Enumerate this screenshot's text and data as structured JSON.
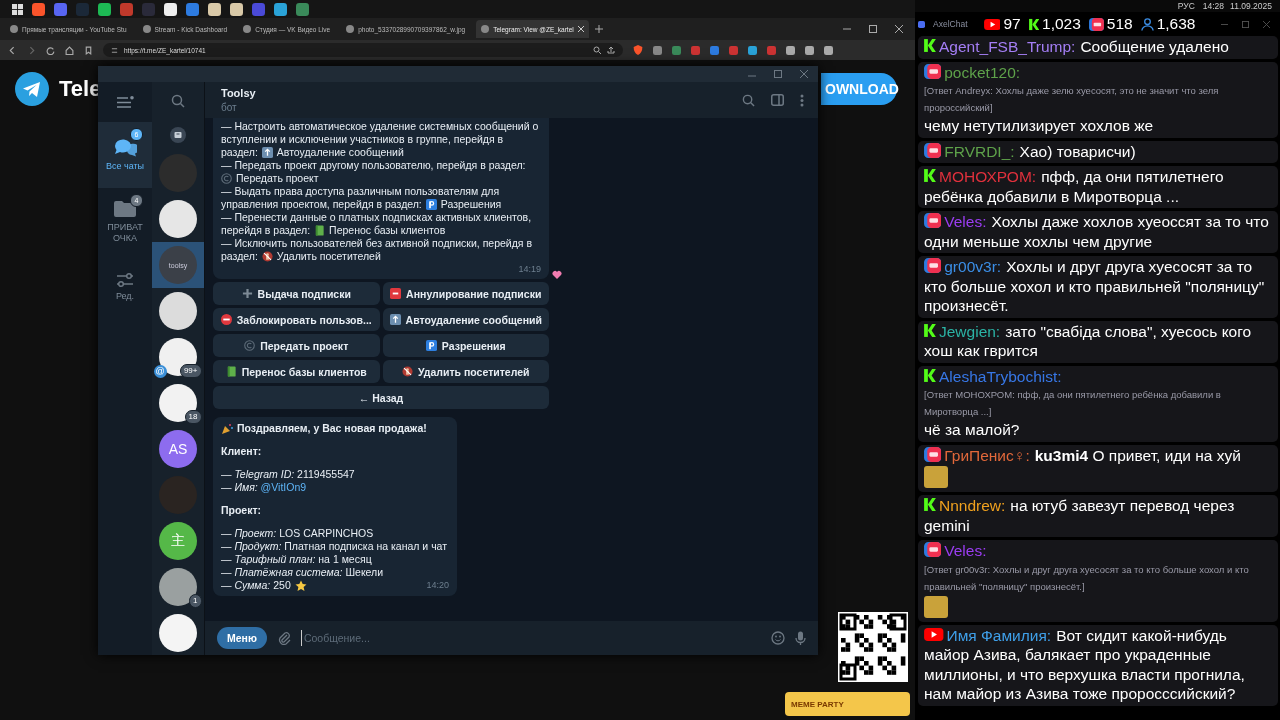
{
  "browser": {
    "tabs": [
      {
        "title": "Прямые трансляции - YouTube Stu",
        "selected": false
      },
      {
        "title": "Stream - Kick Dashboard",
        "selected": false
      },
      {
        "title": "Студия — VK Видео Live",
        "selected": false
      },
      {
        "title": "photo_5337028990709397862_w.jpg",
        "selected": false
      },
      {
        "title": "Telegram: View @ZE_kartel",
        "selected": true
      }
    ],
    "address": "https://t.me/ZE_kartel/10741"
  },
  "system_tray": {
    "language": "РУС",
    "time": "14:28",
    "date": "11.09.2025"
  },
  "web_page": {
    "brand": "Tele",
    "download_button": "OWNLOAD",
    "widget_title": "MEME PARTY"
  },
  "telegram": {
    "folders": [
      {
        "kind": "all",
        "label": "Все чаты",
        "badge": "6",
        "selected": true
      },
      {
        "kind": "folder",
        "label": "ПРИВАТ ОЧКА",
        "badge": "4",
        "selected": false
      },
      {
        "kind": "edit",
        "label": "Ред.",
        "selected": false
      }
    ],
    "chats": [
      {
        "color": "#2c2c2c",
        "selected": false
      },
      {
        "color": "#e6e6e6",
        "selected": false
      },
      {
        "label": "toolsy",
        "color": "#3b4048",
        "selected": true
      },
      {
        "color": "#dcdcdc",
        "selected": false
      },
      {
        "color": "#f0f0f0",
        "mention": "@",
        "badge": "99+",
        "selected": false
      },
      {
        "color": "#f2f2f2",
        "badge": "18",
        "selected": false
      },
      {
        "label": "AS",
        "color": "#8d6cef",
        "selected": false
      },
      {
        "color": "#2a2421",
        "selected": false
      },
      {
        "label": "主",
        "color": "#55b848",
        "selected": false
      },
      {
        "color": "#9aa0a0",
        "badge": "1",
        "selected": false
      },
      {
        "color": "#f4f4f4",
        "selected": false
      }
    ],
    "header": {
      "title": "Toolsy",
      "subtitle": "бот"
    },
    "bot_message": {
      "time": "14:19",
      "lines": [
        {
          "kind": "plain",
          "text": "— Настроить автоматическое удаление системных сообщений о"
        },
        {
          "kind": "plain",
          "text": "вступлении и исключении участников в группе, перейдя в"
        },
        {
          "kind": "autodelete",
          "text": "раздел:",
          "section": "Автоудаление сообщений"
        },
        {
          "kind": "plain",
          "text": "— Передать проект другому пользователю, перейдя в раздел:"
        },
        {
          "kind": "transfer",
          "section": "Передать проект"
        },
        {
          "kind": "plain",
          "text": "— Выдать права доступа различным пользователям для"
        },
        {
          "kind": "permissions",
          "text": "управления проектом, перейдя в раздел:",
          "section": "Разрешения"
        },
        {
          "kind": "plain",
          "text": "— Перенести данные о платных подписках активных клиентов,"
        },
        {
          "kind": "migrate",
          "text": "перейдя в раздел:",
          "section": "Перенос базы клиентов"
        },
        {
          "kind": "plain",
          "text": "— Исключить пользователей без активной подписки, перейдя в"
        },
        {
          "kind": "remove",
          "text": "раздел:",
          "section": "Удалить посетителей"
        }
      ]
    },
    "keyboard": [
      {
        "kind": "grant",
        "label": "Выдача подписки"
      },
      {
        "kind": "revoke",
        "label": "Аннулирование подписки"
      },
      {
        "kind": "block",
        "label": "Заблокировать пользов..."
      },
      {
        "kind": "autodelete",
        "label": "Автоудаление сообщений"
      },
      {
        "kind": "transfer",
        "label": "Передать проект"
      },
      {
        "kind": "permissions",
        "label": "Разрешения"
      },
      {
        "kind": "migrate",
        "label": "Перенос базы клиентов"
      },
      {
        "kind": "remove",
        "label": "Удалить посетителей"
      }
    ],
    "back_button": "← Назад",
    "sale_message": {
      "time": "14:20",
      "lines": [
        {
          "kind": "title",
          "text": "Поздравляем, у Вас новая продажа!"
        },
        {
          "kind": "heading",
          "text": "Клиент:"
        },
        {
          "kind": "field",
          "text": "— *Telegram ID:* 2119455547"
        },
        {
          "kind": "field",
          "text": "— *Имя:*",
          "link": "@VitIOn9"
        },
        {
          "kind": "heading",
          "text": "Проект:"
        },
        {
          "kind": "field",
          "text": "— *Проект:* LOS CARPINCHOS"
        },
        {
          "kind": "field",
          "text": "— *Продукт:* Платная подписка на канал и чат"
        },
        {
          "kind": "field",
          "text": "— *Тарифный план:* на 1 месяц"
        },
        {
          "kind": "field",
          "text": "— *Платёжная система:* Шекели"
        },
        {
          "kind": "amount",
          "text": "— *Сумма:* 250"
        }
      ]
    },
    "input": {
      "menu_button": "Меню",
      "placeholder": "Сообщение..."
    }
  },
  "chat_overlay": {
    "app_title": "AxelChat",
    "stats": [
      {
        "kind": "youtube",
        "value": "97"
      },
      {
        "kind": "kick",
        "value": "1,023"
      },
      {
        "kind": "vk",
        "value": "518"
      },
      {
        "kind": "viewers",
        "value": "1,638"
      }
    ],
    "messages": [
      {
        "kind": "kick",
        "author": "Agent_FSB_Trump:",
        "color": "#a47ef5",
        "text": "Сообщение удалено"
      },
      {
        "kind": "vk",
        "author": "pocket120:",
        "color": "#5ea24a",
        "reply": "[Ответ Andreyx: Хохлы даже зелю хуесосят, это не значит что зеля пророссийский]",
        "text": "чему нетутилизирует хохлов же"
      },
      {
        "kind": "vk",
        "author": "FRVRDI_:",
        "color": "#5ea24a",
        "text": "Хао) товарисчи)"
      },
      {
        "kind": "kick",
        "author": "МОНОХРОМ:",
        "color": "#e0303c",
        "text": "пфф, да они пятилетнего ребёнка добавили в Миротворца ..."
      },
      {
        "kind": "vk",
        "author": "Veles:",
        "color": "#9b3df2",
        "text": "Хохлы даже хохлов хуеоссят за то что одни меньше хохлы чем другие"
      },
      {
        "kind": "vk",
        "author": "gr00v3r:",
        "color": "#3b8ee6",
        "text": "Хохлы и друг друга хуесосят за то кто больше хохол и кто правильней \"поляницу\" произнесёт."
      },
      {
        "kind": "kick",
        "author": "Jewgien:",
        "color": "#2bb3a5",
        "text": "зато \"свабіда слова\", хуесось кого хош как гврится"
      },
      {
        "kind": "kick",
        "author": "AleshaTrybochist:",
        "color": "#3777e6",
        "reply": "[Ответ МОНОХРОМ: пфф, да они пятилетнего ребёнка добавили в Миротворца ...]",
        "text": "чё за малой?"
      },
      {
        "kind": "vk",
        "author": "ГриПенис♀:",
        "color": "#e2683a",
        "text": "**ku3mi4** О привет, иди на хуй",
        "emote": true
      },
      {
        "kind": "kick",
        "author": "Nnndrew:",
        "color": "#f0a11e",
        "text": "на ютуб завезут перевод через gemini"
      },
      {
        "kind": "vk",
        "author": "Veles:",
        "color": "#9b3df2",
        "reply": "[Ответ gr00v3r: Хохлы и друг друга хуесосят за то кто больше хохол и кто правильней \"поляницу\" произнесёт.]",
        "emote": true
      },
      {
        "kind": "youtube",
        "author": "Имя Фамилия:",
        "color": "#3fa0ea",
        "text": "Вот сидит какой-нибудь майор Азива, балякает про украденные миллионы, и что верхушка власти прогнила, нам майор из Азива тоже пророссcийский?"
      }
    ]
  }
}
